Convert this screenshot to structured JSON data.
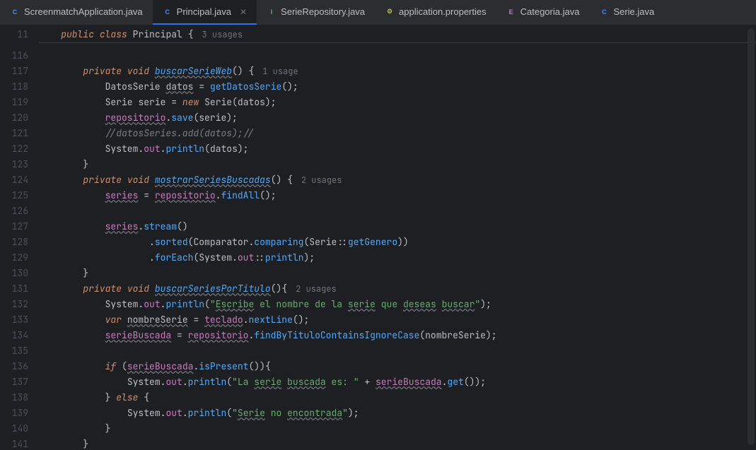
{
  "tabs": [
    {
      "name": "ScreenmatchApplication.java",
      "icon": "C",
      "iconClass": "java"
    },
    {
      "name": "Principal.java",
      "icon": "C",
      "iconClass": "java",
      "active": true
    },
    {
      "name": "SerieRepository.java",
      "icon": "I",
      "iconClass": "interface"
    },
    {
      "name": "application.properties",
      "icon": "⚙",
      "iconClass": "props"
    },
    {
      "name": "Categoria.java",
      "icon": "E",
      "iconClass": "enum"
    },
    {
      "name": "Serie.java",
      "icon": "C",
      "iconClass": "java"
    }
  ],
  "class_line": {
    "public": "public",
    "class": "class",
    "name": "Principal",
    "brace": " {",
    "usages": "3 usages"
  },
  "gutter_first": "11",
  "gutter_lines": [
    "116",
    "117",
    "118",
    "119",
    "120",
    "121",
    "122",
    "123",
    "124",
    "125",
    "126",
    "127",
    "128",
    "129",
    "130",
    "131",
    "132",
    "133",
    "134",
    "135",
    "136",
    "137",
    "138",
    "139",
    "140",
    "141"
  ],
  "c": {
    "private": "private",
    "void": "void",
    "new": "new",
    "var": "var",
    "if": "if",
    "else": "else",
    "buscarSerieWeb": "buscarSerieWeb",
    "u1": "1 usage",
    "u2": "2 usages",
    "DatosSerie": "DatosSerie",
    "datos": "datos",
    "getDatosSerie": "getDatosSerie",
    "Serie": "Serie",
    "serie": "serie",
    "repositorio": "repositorio",
    "save": "save",
    "comment1": "//datosSeries.add(datos);//",
    "System": "System",
    "out": "out",
    "println": "println",
    "mostrarSeriesBuscadas": "mostrarSeriesBuscadas",
    "series": "series",
    "findAll": "findAll",
    "stream": "stream",
    "sorted": "sorted",
    "Comparator": "Comparator",
    "comparing": "comparing",
    "getGenero": "getGenero",
    "forEach": "forEach",
    "buscarSeriesPorTitulo": "buscarSeriesPorTitulo",
    "str_escribe": "\"Escribe el nombre de la serie que deseas buscar\"",
    "nombreSerie": "nombreSerie",
    "teclado": "teclado",
    "nextLine": "nextLine",
    "serieBuscada": "serieBuscada",
    "findByTituloContainsIgnoreCase": "findByTituloContainsIgnoreCase",
    "isPresent": "isPresent",
    "str_found": "\"La serie buscada es: \"",
    "get": "get",
    "str_notfound": "\"Serie no encontrada\""
  }
}
